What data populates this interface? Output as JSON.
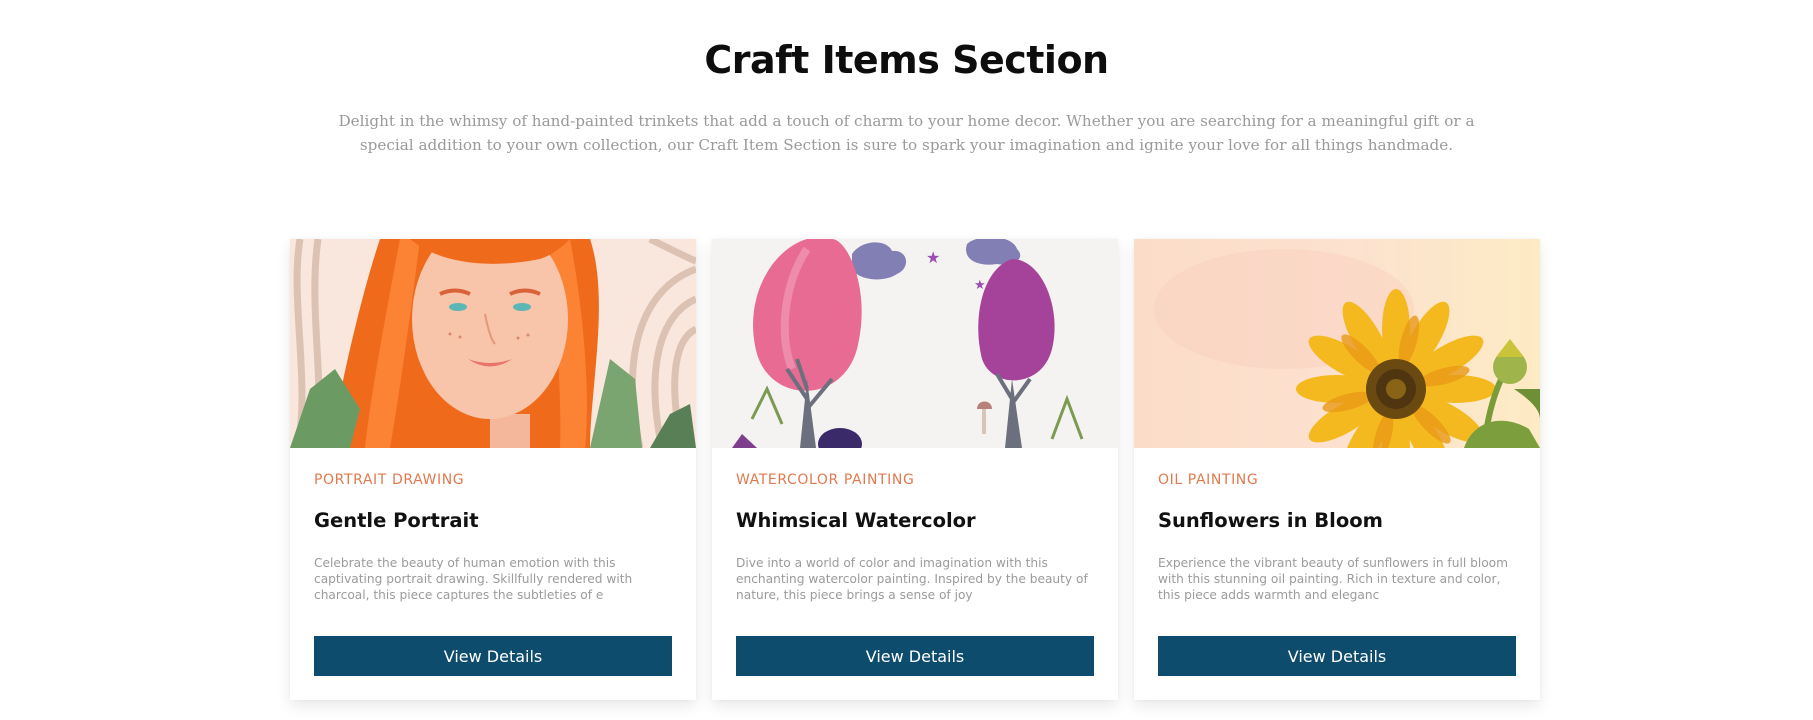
{
  "section": {
    "title": "Craft Items Section",
    "description": "Delight in the whimsy of hand-painted trinkets that add a touch of charm to your home decor. Whether you are searching for a meaningful gift or a special addition to your own collection, our Craft Item Section is sure to spark your imagination and ignite your love for all things handmade."
  },
  "colors": {
    "accent": "#e07a4e",
    "button": "#0e4c6d",
    "muted_text": "#9b9b9b"
  },
  "cards": [
    {
      "category": "Portrait Drawing",
      "title": "Gentle Portrait",
      "description": "Celebrate the beauty of human emotion with this captivating portrait drawing. Skillfully rendered with charcoal, this piece captures the subtleties of e",
      "button_label": "View Details",
      "image": "portrait-illustration"
    },
    {
      "category": "Watercolor Painting",
      "title": "Whimsical Watercolor",
      "description": "Dive into a world of color and imagination with this enchanting watercolor painting. Inspired by the beauty of nature, this piece brings a sense of joy",
      "button_label": "View Details",
      "image": "watercolor-trees-illustration"
    },
    {
      "category": "Oil Painting",
      "title": "Sunflowers in Bloom",
      "description": "Experience the vibrant beauty of sunflowers in full bloom with this stunning oil painting. Rich in texture and color, this piece adds warmth and eleganc",
      "button_label": "View Details",
      "image": "sunflower-illustration"
    }
  ]
}
